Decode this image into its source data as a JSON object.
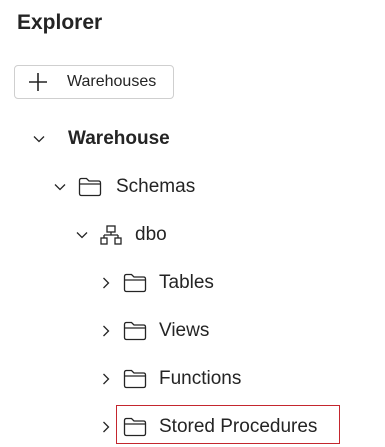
{
  "explorer": {
    "title": "Explorer",
    "add_button": {
      "icon": "plus-icon",
      "label": "Warehouses"
    },
    "tree": {
      "warehouse": {
        "label": "Warehouse",
        "expanded": true,
        "icon": "chevron-down-icon"
      },
      "schemas": {
        "label": "Schemas",
        "expanded": true,
        "icon": "folder-icon"
      },
      "dbo": {
        "label": "dbo",
        "expanded": true,
        "icon": "schema-icon"
      },
      "tables": {
        "label": "Tables",
        "expanded": false,
        "icon": "folder-icon"
      },
      "views": {
        "label": "Views",
        "expanded": false,
        "icon": "folder-icon"
      },
      "functions": {
        "label": "Functions",
        "expanded": false,
        "icon": "folder-icon"
      },
      "stored_procedures": {
        "label": "Stored Procedures",
        "expanded": false,
        "icon": "folder-icon",
        "highlighted": true
      }
    },
    "colors": {
      "text": "#242424",
      "highlight_border": "#c4262e",
      "button_border": "#cfcfcf"
    }
  }
}
